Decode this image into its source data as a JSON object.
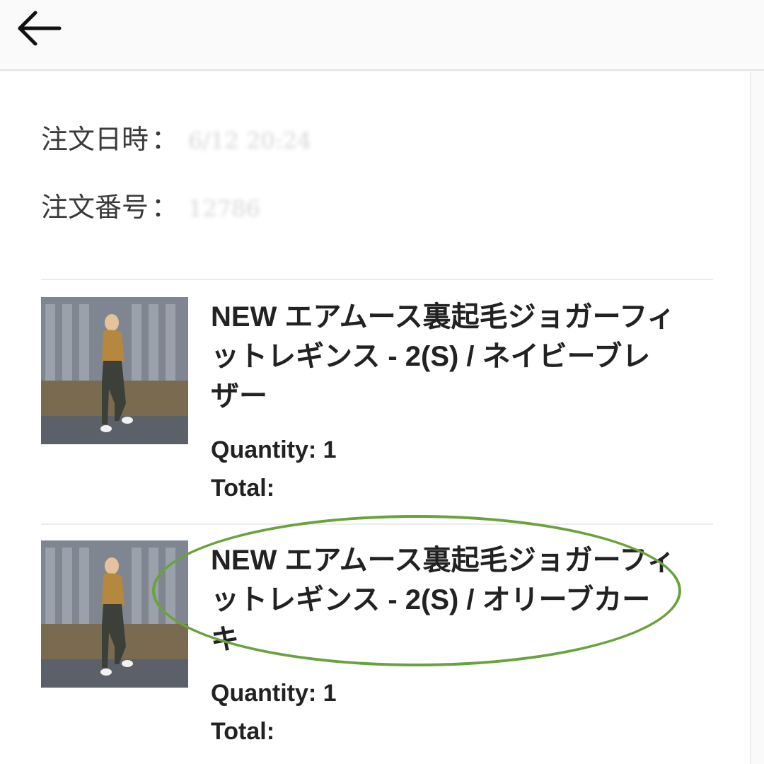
{
  "header": {
    "back_icon": "arrow-left-icon"
  },
  "order": {
    "date_label": "注文日時",
    "date_colon": "：",
    "date_value": "6/12 20:24",
    "number_label": "注文番号",
    "number_colon": "：",
    "number_value": "12786"
  },
  "items": [
    {
      "title": "NEW エアムース裏起毛ジョガーフィットレギンス - 2(S) / ネイビーブレザー",
      "quantity": "Quantity: 1",
      "total": "Total:",
      "image": "product-photo-woman-mustard-top-dark-joggers"
    },
    {
      "title": "NEW エアムース裏起毛ジョガーフィットレギンス - 2(S) / オリーブカーキ",
      "quantity": "Quantity: 1",
      "total": "Total:",
      "image": "product-photo-woman-mustard-top-dark-joggers"
    }
  ],
  "highlight_color": "#6aa23d"
}
